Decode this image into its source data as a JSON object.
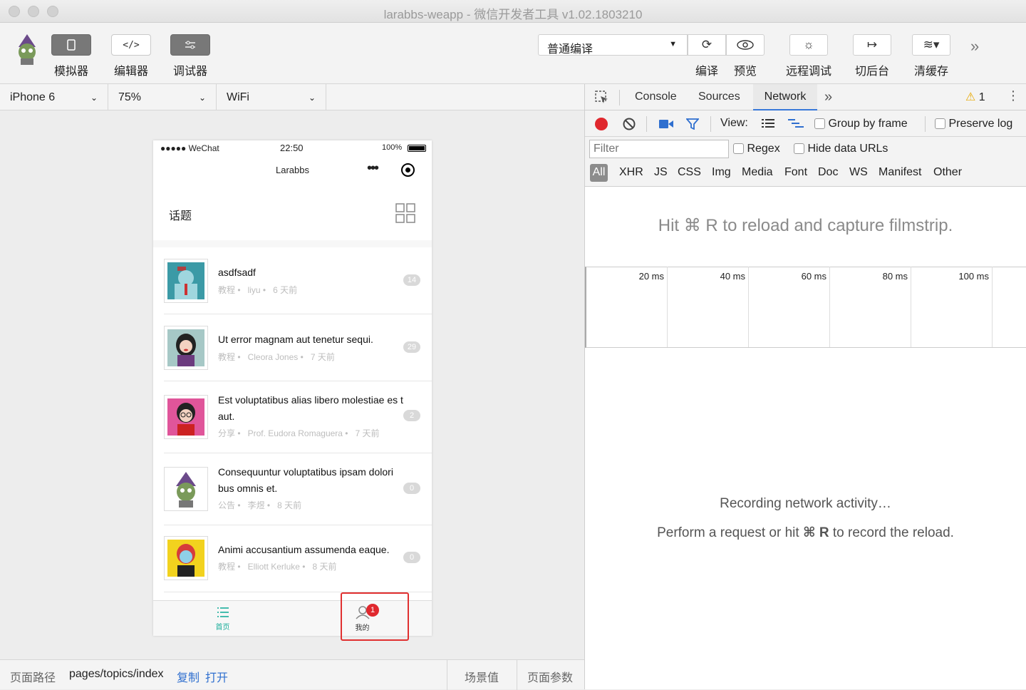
{
  "window": {
    "title": "larabbs-weapp - 微信开发者工具 v1.02.1803210"
  },
  "toolbar": {
    "left_buttons": [
      {
        "label": "模拟器",
        "icon": "phone-icon"
      },
      {
        "label": "编辑器",
        "icon": "code-icon"
      },
      {
        "label": "调试器",
        "icon": "debugger-icon"
      }
    ],
    "compile_select": "普通编译",
    "right_buttons": [
      {
        "label": "编译",
        "icon": "refresh-icon"
      },
      {
        "label": "预览",
        "icon": "eye-icon"
      },
      {
        "label": "远程调试",
        "icon": "bug-icon"
      },
      {
        "label": "切后台",
        "icon": "switch-icon"
      },
      {
        "label": "清缓存",
        "icon": "layers-icon"
      }
    ]
  },
  "device_bar": {
    "device": "iPhone 6",
    "zoom": "75%",
    "network": "WiFi"
  },
  "phone": {
    "status": {
      "carrier": "●●●●● WeChat",
      "time": "22:50",
      "battery": "100%"
    },
    "nav_title": "Larabbs",
    "page_title": "话题",
    "topics": [
      {
        "title": "asdfsadf",
        "category": "教程",
        "author": "liyu",
        "time": "6 天前",
        "replies": "14"
      },
      {
        "title": "Ut error magnam aut tenetur sequi.",
        "category": "教程",
        "author": "Cleora Jones",
        "time": "7 天前",
        "replies": "29"
      },
      {
        "title": "Est voluptatibus alias libero molestiae es t aut.",
        "category": "分享",
        "author": "Prof. Eudora Romaguera",
        "time": "7 天前",
        "replies": "2"
      },
      {
        "title": "Consequuntur voluptatibus ipsam dolori bus omnis et.",
        "category": "公告",
        "author": "李煜",
        "time": "8 天前",
        "replies": "0"
      },
      {
        "title": "Animi accusantium assumenda eaque.",
        "category": "教程",
        "author": "Elliott Kerluke",
        "time": "8 天前",
        "replies": "0"
      }
    ],
    "tabs": [
      {
        "label": "首页",
        "icon": "list-icon",
        "active": true
      },
      {
        "label": "我的",
        "icon": "user-icon",
        "badge": "1"
      }
    ]
  },
  "footer": {
    "path_label": "页面路径",
    "path": "pages/topics/index",
    "copy": "复制",
    "open": "打开",
    "scene": "场景值",
    "params": "页面参数"
  },
  "devtools": {
    "tabs": [
      "Console",
      "Sources",
      "Network"
    ],
    "active_tab": "Network",
    "warning_count": "1",
    "view_label": "View:",
    "group_by_frame": "Group by frame",
    "preserve_log": "Preserve log",
    "filter_placeholder": "Filter",
    "regex": "Regex",
    "hide_data_urls": "Hide data URLs",
    "types": [
      "All",
      "XHR",
      "JS",
      "CSS",
      "Img",
      "Media",
      "Font",
      "Doc",
      "WS",
      "Manifest",
      "Other"
    ],
    "hint": "Hit ⌘ R to reload and capture filmstrip.",
    "timeline": [
      "20 ms",
      "40 ms",
      "60 ms",
      "80 ms",
      "100 ms"
    ],
    "recording": "Recording network activity…",
    "perform_prefix": "Perform a request or hit ",
    "perform_key": "⌘ R",
    "perform_suffix": " to record the reload."
  },
  "colors": {
    "accent_teal": "#1aad9b",
    "record_red": "#e0282e",
    "link_blue": "#2f6fcf",
    "badge_red": "#e0282e"
  }
}
